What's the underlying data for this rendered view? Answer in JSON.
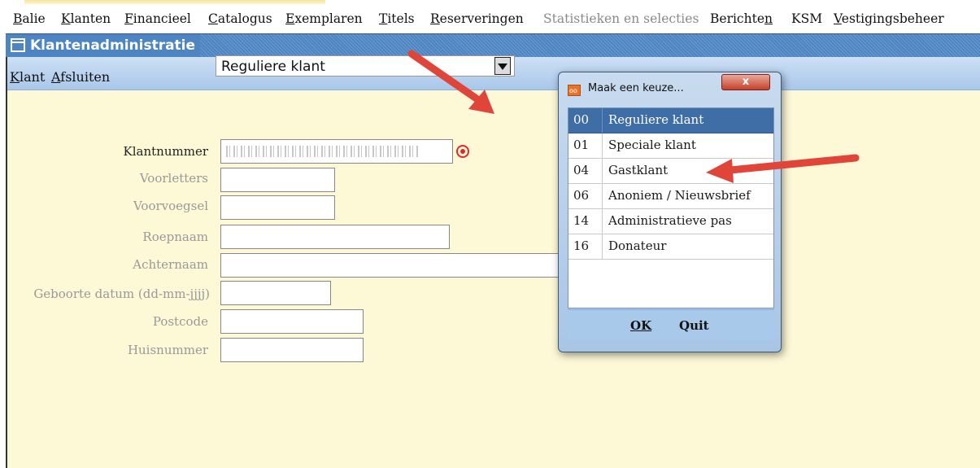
{
  "menu": [
    {
      "label": "Balie",
      "accel": "B"
    },
    {
      "label": "Klanten",
      "accel": "K"
    },
    {
      "label": "Financieel",
      "accel": "F"
    },
    {
      "label": "Catalogus",
      "accel": "C"
    },
    {
      "label": "Exemplaren",
      "accel": "E"
    },
    {
      "label": "Titels",
      "accel": "T"
    },
    {
      "label": "Reserveringen",
      "accel": "R"
    },
    {
      "label": "Statistieken en selecties",
      "accel": ""
    },
    {
      "label": "Berichten",
      "accel": "n"
    },
    {
      "label": "KSM",
      "accel": ""
    },
    {
      "label": "Vestigingsbeheer",
      "accel": "V"
    }
  ],
  "window": {
    "title": "Klantenadministratie"
  },
  "submenu": {
    "klant": "Klant",
    "afsluiten": "Afsluiten"
  },
  "form": {
    "type_select": "Reguliere klant",
    "labels": {
      "klantnummer": "Klantnummer",
      "voorletters": "Voorletters",
      "voorvoegsel": "Voorvoegsel",
      "roepnaam": "Roepnaam",
      "achternaam": "Achternaam",
      "geboortedatum": "Geboorte datum (dd-mm-jjjj)",
      "postcode": "Postcode",
      "huisnummer": "Huisnummer"
    }
  },
  "dialog": {
    "title": "Maak een keuze...",
    "close": "x",
    "options": [
      {
        "code": "00",
        "name": "Reguliere klant",
        "selected": true
      },
      {
        "code": "01",
        "name": "Speciale klant",
        "selected": false
      },
      {
        "code": "04",
        "name": "Gastklant",
        "selected": false
      },
      {
        "code": "06",
        "name": "Anoniem / Nieuwsbrief",
        "selected": false
      },
      {
        "code": "14",
        "name": "Administratieve pas",
        "selected": false
      },
      {
        "code": "16",
        "name": "Donateur",
        "selected": false
      }
    ],
    "ok": "OK",
    "quit": "Quit"
  },
  "colors": {
    "title_bar": "#4d84c2",
    "form_background": "#fdf8d6",
    "selected_row": "#3f6da6",
    "annotation_arrow": "#e0453a"
  }
}
